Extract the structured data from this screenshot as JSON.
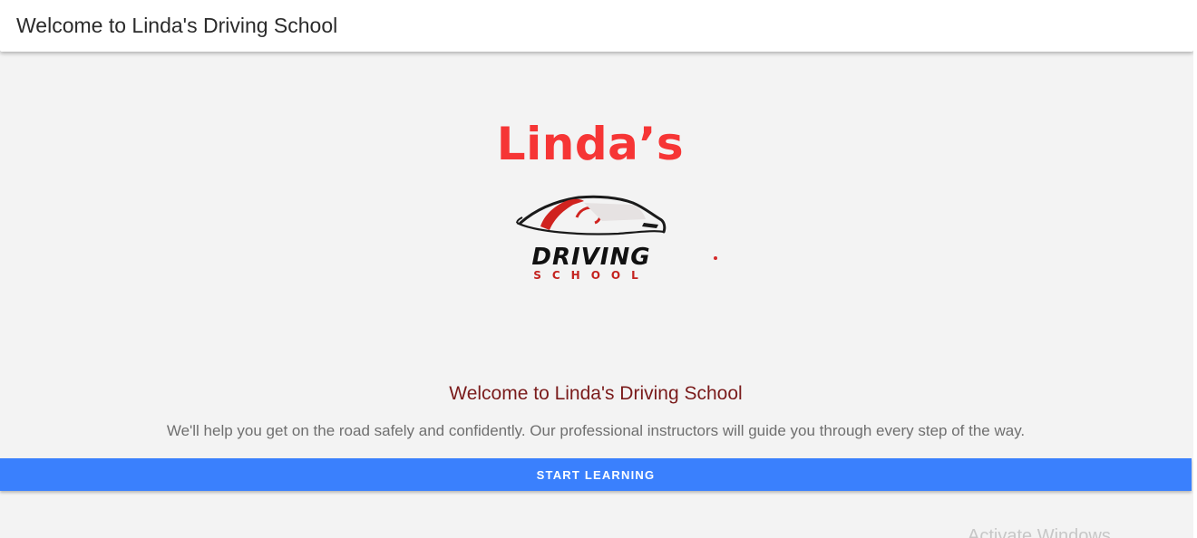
{
  "toolbar": {
    "title": "Welcome to Linda's Driving School"
  },
  "hero": {
    "brand_name": "Linda’s",
    "logo": {
      "icon": "car-silhouette-icon",
      "line1": "DRIVING",
      "line2": "SCHOOL"
    },
    "headline": "Welcome to Linda's Driving School",
    "subtext": "We'll help you get on the road safely and confidently. Our professional instructors will guide you through every step of the way.",
    "cta_label": "START LEARNING"
  },
  "system": {
    "watermark": "Activate Windows"
  },
  "colors": {
    "brand_red": "#f63535",
    "headline": "#7a1b1b",
    "button_blue": "#3a80fd",
    "background": "#f3f3f3"
  }
}
